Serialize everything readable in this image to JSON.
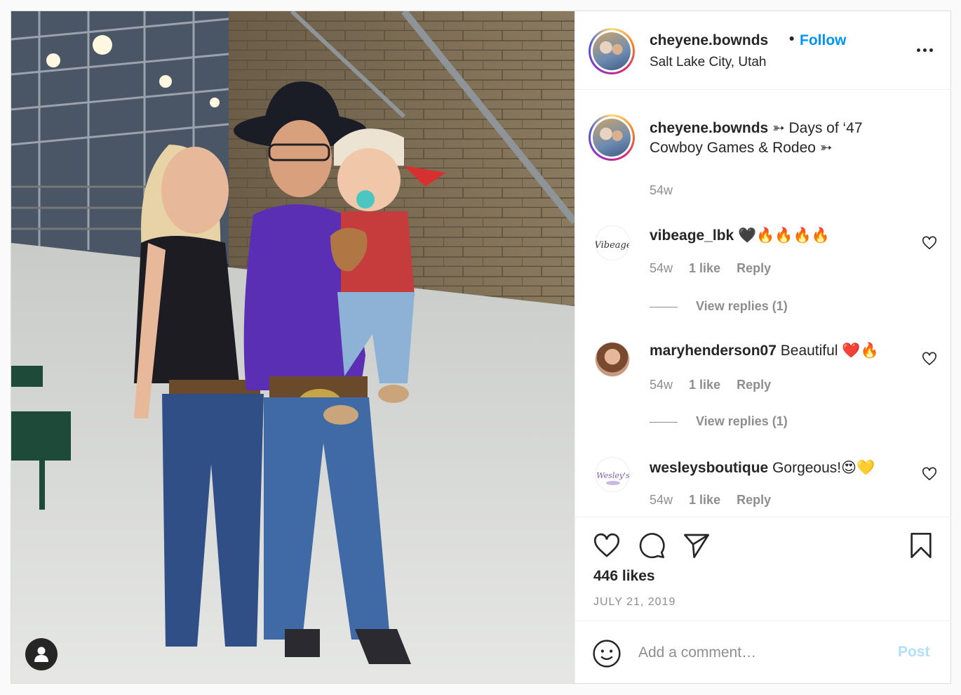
{
  "post": {
    "username": "cheyene.bownds",
    "follow_label": "Follow",
    "separator": "•",
    "location": "Salt Lake City, Utah",
    "caption": "➳ Days of ‘47 Cowboy Games & Rodeo ➳",
    "caption_time": "54w"
  },
  "comments": [
    {
      "user": "vibeage_lbk",
      "text": "🖤🔥🔥🔥🔥",
      "time": "54w",
      "likes": "1 like",
      "reply": "Reply",
      "view_replies": "View replies (1)"
    },
    {
      "user": "maryhenderson07",
      "text": "Beautiful ❤️🔥",
      "time": "54w",
      "likes": "1 like",
      "reply": "Reply",
      "view_replies": "View replies (1)"
    },
    {
      "user": "wesleysboutique",
      "text": "Gorgeous!😍💛",
      "time": "54w",
      "likes": "1 like",
      "reply": "Reply"
    }
  ],
  "stats": {
    "likes": "446 likes",
    "date": "JULY 21, 2019"
  },
  "composer": {
    "placeholder": "Add a comment…",
    "post_label": "Post"
  },
  "icons": {
    "more": "more-options-icon",
    "like": "heart-icon",
    "comment": "comment-bubble-icon",
    "share": "paper-plane-icon",
    "save": "bookmark-icon",
    "emoji": "smiley-icon",
    "tagged": "person-icon"
  },
  "colors": {
    "accent": "#0095f6",
    "post_disabled": "#b3dffc",
    "muted": "#8e8e8e"
  }
}
